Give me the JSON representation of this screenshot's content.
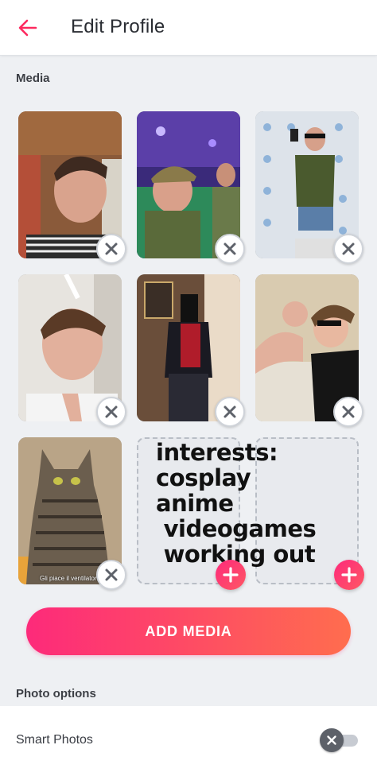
{
  "header": {
    "title": "Edit Profile",
    "back_icon": "arrow-left-icon",
    "accent": "#fd2a5f"
  },
  "media_section": {
    "label": "Media"
  },
  "tiles": [
    {
      "type": "photo",
      "description": "selfie outdoors"
    },
    {
      "type": "photo",
      "description": "airsoft group selfie"
    },
    {
      "type": "photo",
      "description": "mirror selfie green shirt"
    },
    {
      "type": "photo",
      "description": "selfie peace sign"
    },
    {
      "type": "photo",
      "description": "mirror selfie costume"
    },
    {
      "type": "photo",
      "description": "flexing with sunglasses"
    },
    {
      "type": "photo",
      "description": "cat photo",
      "caption": "Gli piace il ventilatore"
    },
    {
      "type": "empty"
    },
    {
      "type": "empty"
    }
  ],
  "overlay_text": "interests:\ncosplay\nanime\n videogames\n working out",
  "add_media_button": {
    "label": "ADD MEDIA"
  },
  "photo_options": {
    "label": "Photo options"
  },
  "smart_photos": {
    "label": "Smart Photos",
    "enabled": false
  }
}
